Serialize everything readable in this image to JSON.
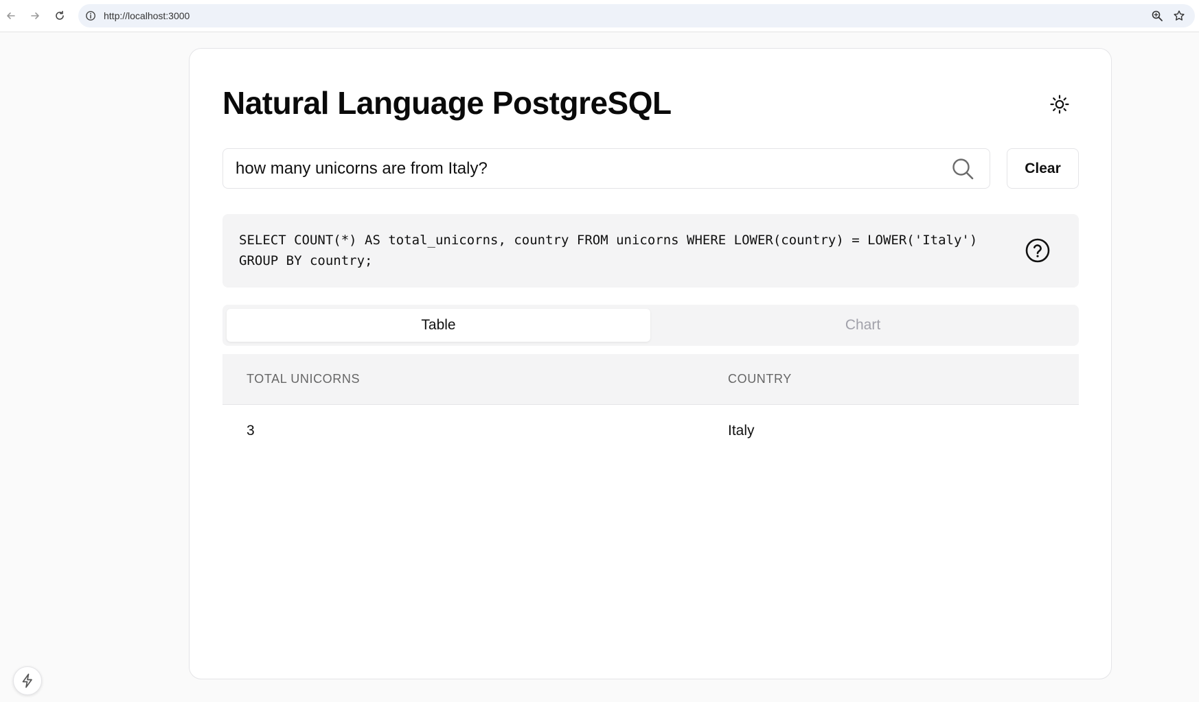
{
  "browser": {
    "url": "http://localhost:3000",
    "icons": [
      "back-arrow-icon",
      "forward-arrow-icon",
      "reload-icon",
      "info-icon",
      "zoom-icon",
      "star-icon"
    ]
  },
  "header": {
    "title": "Natural Language PostgreSQL",
    "theme_icon": "sun-icon"
  },
  "search": {
    "value": "how many unicorns are from Italy?",
    "icon": "search-icon",
    "clear_label": "Clear"
  },
  "query": {
    "sql": "SELECT COUNT(*) AS total_unicorns, country FROM unicorns WHERE LOWER(country) = LOWER('Italy')\nGROUP BY country;",
    "help_icon": "question-circle-icon"
  },
  "tabs": [
    {
      "label": "Table",
      "active": true
    },
    {
      "label": "Chart",
      "active": false
    }
  ],
  "table": {
    "headers": [
      "TOTAL UNICORNS",
      "COUNTRY"
    ],
    "rows": [
      [
        "3",
        "Italy"
      ]
    ]
  },
  "colors": {
    "background": "#fafafa",
    "card": "#ffffff",
    "muted": "#f4f4f5",
    "border": "#e4e4e7",
    "text": "#111111",
    "muted_text": "#a1a1aa"
  }
}
